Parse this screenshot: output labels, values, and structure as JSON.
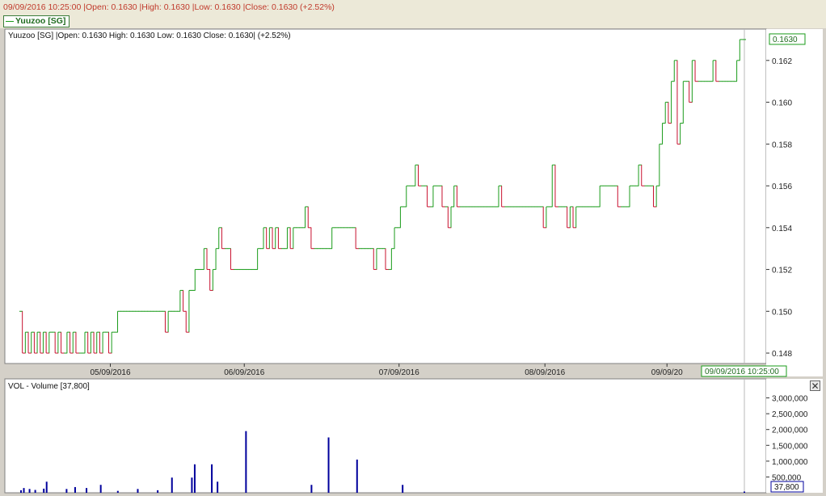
{
  "header": {
    "quote_line": "09/09/2016 10:25:00 |Open: 0.1630 |High: 0.1630 |Low: 0.1630 |Close: 0.1630 (+2.52%)",
    "legend_label": "Yuuzoo [SG]"
  },
  "colors": {
    "up": "#1a9b1a",
    "down": "#c8102e",
    "volume": "#00009c",
    "grid": "#d8d8d8"
  },
  "chart_data": [
    {
      "type": "line",
      "chart_title": "Yuuzoo [SG] |Open: 0.1630  High: 0.1630  Low: 0.1630  Close: 0.1630| (+2.52%)",
      "ylim": [
        0.1475,
        0.1635
      ],
      "yticks": [
        "0.148",
        "0.150",
        "0.152",
        "0.154",
        "0.156",
        "0.158",
        "0.160",
        "0.162"
      ],
      "xticks": [
        {
          "label": "05/09/2016",
          "index": 30
        },
        {
          "label": "06/09/2016",
          "index": 75
        },
        {
          "label": "07/09/2016",
          "index": 127
        },
        {
          "label": "08/09/2016",
          "index": 176
        },
        {
          "label": "09/09/20",
          "index": 217
        }
      ],
      "last_value_label": "0.1630",
      "cursor_label": "09/09/2016 10:25:00",
      "series": [
        {
          "values": [
            0.15,
            0.148,
            0.149,
            0.148,
            0.149,
            0.148,
            0.149,
            0.148,
            0.149,
            0.148,
            0.149,
            0.149,
            0.148,
            0.149,
            0.148,
            0.148,
            0.149,
            0.148,
            0.149,
            0.148,
            0.148,
            0.148,
            0.149,
            0.148,
            0.149,
            0.148,
            0.149,
            0.148,
            0.149,
            0.149,
            0.148,
            0.149,
            0.149,
            0.15,
            0.15,
            0.15,
            0.15,
            0.15,
            0.15,
            0.15,
            0.15,
            0.15,
            0.15,
            0.15,
            0.15,
            0.15,
            0.15,
            0.15,
            0.15,
            0.149,
            0.15,
            0.15,
            0.15,
            0.15,
            0.151,
            0.15,
            0.149,
            0.151,
            0.151,
            0.152,
            0.152,
            0.152,
            0.153,
            0.152,
            0.151,
            0.152,
            0.153,
            0.154,
            0.153,
            0.153,
            0.153,
            0.152,
            0.152,
            0.152,
            0.152,
            0.152,
            0.152,
            0.152,
            0.152,
            0.152,
            0.153,
            0.153,
            0.154,
            0.153,
            0.154,
            0.153,
            0.154,
            0.153,
            0.153,
            0.153,
            0.154,
            0.153,
            0.154,
            0.154,
            0.154,
            0.154,
            0.155,
            0.154,
            0.153,
            0.153,
            0.153,
            0.153,
            0.153,
            0.153,
            0.153,
            0.154,
            0.154,
            0.154,
            0.154,
            0.154,
            0.154,
            0.154,
            0.154,
            0.153,
            0.153,
            0.153,
            0.153,
            0.153,
            0.153,
            0.152,
            0.153,
            0.153,
            0.153,
            0.152,
            0.152,
            0.153,
            0.154,
            0.154,
            0.155,
            0.155,
            0.156,
            0.156,
            0.156,
            0.157,
            0.156,
            0.156,
            0.156,
            0.155,
            0.155,
            0.156,
            0.156,
            0.156,
            0.155,
            0.155,
            0.154,
            0.155,
            0.156,
            0.155,
            0.155,
            0.155,
            0.155,
            0.155,
            0.155,
            0.155,
            0.155,
            0.155,
            0.155,
            0.155,
            0.155,
            0.155,
            0.155,
            0.156,
            0.155,
            0.155,
            0.155,
            0.155,
            0.155,
            0.155,
            0.155,
            0.155,
            0.155,
            0.155,
            0.155,
            0.155,
            0.155,
            0.155,
            0.154,
            0.155,
            0.155,
            0.157,
            0.155,
            0.155,
            0.155,
            0.155,
            0.154,
            0.155,
            0.154,
            0.155,
            0.155,
            0.155,
            0.155,
            0.155,
            0.155,
            0.155,
            0.155,
            0.156,
            0.156,
            0.156,
            0.156,
            0.156,
            0.156,
            0.155,
            0.155,
            0.155,
            0.155,
            0.156,
            0.156,
            0.156,
            0.157,
            0.156,
            0.156,
            0.156,
            0.156,
            0.155,
            0.156,
            0.158,
            0.159,
            0.16,
            0.159,
            0.161,
            0.162,
            0.158,
            0.159,
            0.161,
            0.161,
            0.16,
            0.162,
            0.161,
            0.161,
            0.161,
            0.161,
            0.161,
            0.161,
            0.162,
            0.161,
            0.161,
            0.161,
            0.161,
            0.161,
            0.161,
            0.161,
            0.162,
            0.163,
            0.163
          ]
        }
      ]
    },
    {
      "type": "bar",
      "chart_title": "VOL - Volume [37,800]",
      "ylim": [
        0,
        3500000
      ],
      "yticks": [
        "500,000",
        "1,000,000",
        "1,500,000",
        "2,000,000",
        "2,500,000",
        "3,000,000"
      ],
      "last_value_label": "37,800",
      "series": [
        {
          "values": [
            80000,
            150000,
            0,
            120000,
            0,
            90000,
            0,
            0,
            130000,
            350000,
            0,
            0,
            0,
            0,
            0,
            0,
            120000,
            0,
            0,
            180000,
            0,
            0,
            0,
            150000,
            0,
            0,
            0,
            0,
            250000,
            0,
            0,
            0,
            0,
            0,
            60000,
            0,
            0,
            0,
            0,
            0,
            0,
            120000,
            0,
            0,
            0,
            0,
            0,
            0,
            80000,
            0,
            0,
            0,
            0,
            480000,
            0,
            0,
            0,
            0,
            0,
            0,
            480000,
            900000,
            0,
            0,
            0,
            0,
            0,
            900000,
            0,
            350000,
            0,
            0,
            0,
            0,
            0,
            0,
            0,
            0,
            0,
            1950000,
            0,
            0,
            0,
            0,
            0,
            0,
            0,
            0,
            0,
            0,
            0,
            0,
            0,
            0,
            0,
            0,
            0,
            0,
            0,
            0,
            0,
            0,
            250000,
            0,
            0,
            0,
            0,
            0,
            1750000,
            0,
            0,
            0,
            0,
            0,
            0,
            0,
            0,
            0,
            1050000,
            0,
            0,
            0,
            0,
            0,
            0,
            0,
            0,
            0,
            0,
            0,
            0,
            0,
            0,
            0,
            250000,
            0,
            0,
            0,
            0,
            0,
            0,
            0,
            0,
            0,
            0,
            0,
            0,
            0,
            0,
            0,
            0,
            0,
            0,
            0,
            0,
            0,
            0,
            0,
            0,
            0,
            0,
            0,
            0,
            0,
            0,
            0,
            0,
            0,
            0,
            0,
            0,
            0,
            0,
            0,
            0,
            0,
            0,
            0,
            0,
            0,
            0,
            0,
            0,
            0,
            0,
            0,
            0,
            0,
            0,
            0,
            0,
            0,
            0,
            0,
            0,
            0,
            0,
            0,
            0,
            0,
            0,
            0,
            0,
            0,
            0,
            0,
            0,
            0,
            0,
            0,
            0,
            0,
            0,
            0,
            0,
            0,
            0,
            0,
            0,
            0,
            0,
            0,
            0,
            0,
            0,
            0,
            0,
            0,
            0,
            0,
            0,
            0,
            0,
            0,
            0,
            0,
            0,
            0,
            0,
            0,
            0,
            0,
            0,
            0,
            0,
            0,
            0,
            0,
            0,
            0,
            0,
            0,
            0,
            0,
            37800
          ]
        }
      ]
    }
  ]
}
